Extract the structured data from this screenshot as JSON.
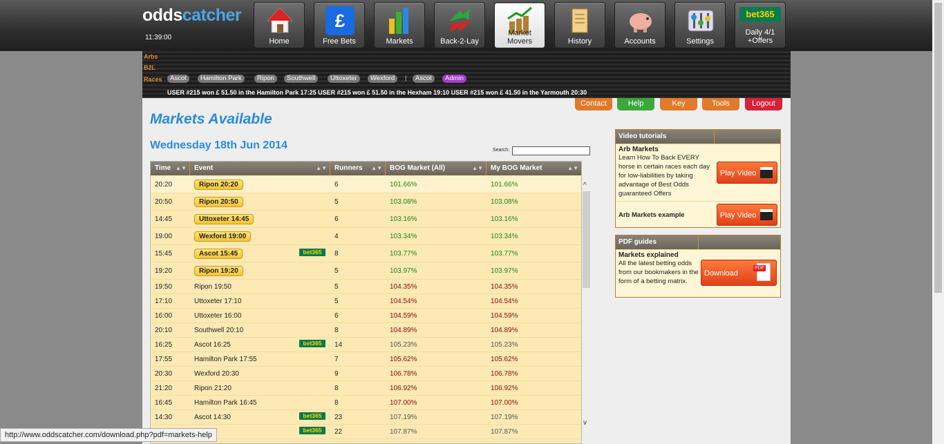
{
  "brand": {
    "part1": "odds",
    "part2": "catcher"
  },
  "clock": "11:39:00",
  "nav": [
    {
      "label": "Home",
      "icon": "house-icon"
    },
    {
      "label": "Free Bets",
      "icon": "pound-icon"
    },
    {
      "label": "Markets",
      "icon": "bar-chart-icon"
    },
    {
      "label": "Back-2-Lay",
      "icon": "arrows-icon"
    },
    {
      "label": "Market Movers",
      "icon": "coins-chart-icon"
    },
    {
      "label": "History",
      "icon": "scroll-icon"
    },
    {
      "label": "Accounts",
      "icon": "piggy-bank-icon"
    },
    {
      "label": "Settings",
      "icon": "settings-icon"
    },
    {
      "label": "Daily 4/1 +Offers",
      "icon": "bet365-icon",
      "badge": "bet365"
    }
  ],
  "subnav": {
    "arbs": "Arbs",
    "b2l": "B2L",
    "races": "Races",
    "race_pills": [
      "Ascot",
      "Hamilton Park",
      "Ripon",
      "Southwell",
      "Uttoxeter",
      "Wexford"
    ],
    "separator": "|",
    "extra_pills": [
      "Ascot",
      "Admin"
    ],
    "ticker": "USER #215 won £ 51.50 in the Hamilton Park 17:25     USER #215 won £ 51.50 in the Hexham 19:10     USER #215 won £ 41.50 in the Yarmouth 20:30"
  },
  "top_buttons": [
    {
      "label": "Contact",
      "color": "#e07a2a"
    },
    {
      "label": "Help",
      "color": "#3aa83a"
    },
    {
      "label": "Key",
      "color": "#e07a2a"
    },
    {
      "label": "Tools",
      "color": "#e07a2a"
    },
    {
      "label": "Logout",
      "color": "#d8203a"
    }
  ],
  "title": "Markets Available",
  "date": "Wednesday 18th Jun 2014",
  "search_label": "Search:",
  "columns": [
    "Time",
    "Event",
    "Runners",
    "BOG Market (All)",
    "My BOG Market"
  ],
  "rows": [
    {
      "time": "20:20",
      "event": "Ripon 20:20",
      "runners": "6",
      "bog": "101.66%",
      "my": "101.66%",
      "btn": true,
      "b365": false,
      "cls": "g"
    },
    {
      "time": "20:50",
      "event": "Ripon 20:50",
      "runners": "5",
      "bog": "103.08%",
      "my": "103.08%",
      "btn": true,
      "b365": false,
      "cls": "g"
    },
    {
      "time": "14:45",
      "event": "Uttoxeter 14:45",
      "runners": "6",
      "bog": "103.16%",
      "my": "103.16%",
      "btn": true,
      "b365": false,
      "cls": "g"
    },
    {
      "time": "19:00",
      "event": "Wexford 19:00",
      "runners": "4",
      "bog": "103.34%",
      "my": "103.34%",
      "btn": true,
      "b365": false,
      "cls": "g"
    },
    {
      "time": "15:45",
      "event": "Ascot 15:45",
      "runners": "8",
      "bog": "103.77%",
      "my": "103.77%",
      "btn": true,
      "b365": true,
      "cls": "g"
    },
    {
      "time": "19:20",
      "event": "Ripon 19:20",
      "runners": "5",
      "bog": "103.97%",
      "my": "103.97%",
      "btn": true,
      "b365": false,
      "cls": "g"
    },
    {
      "time": "19:50",
      "event": "Ripon 19:50",
      "runners": "5",
      "bog": "104.35%",
      "my": "104.35%",
      "btn": false,
      "b365": false,
      "cls": "r"
    },
    {
      "time": "17:10",
      "event": "Uttoxeter 17:10",
      "runners": "5",
      "bog": "104.54%",
      "my": "104.54%",
      "btn": false,
      "b365": false,
      "cls": "r"
    },
    {
      "time": "16:00",
      "event": "Uttoxeter 16:00",
      "runners": "6",
      "bog": "104.59%",
      "my": "104.59%",
      "btn": false,
      "b365": false,
      "cls": "r"
    },
    {
      "time": "20:10",
      "event": "Southwell 20:10",
      "runners": "8",
      "bog": "104.89%",
      "my": "104.89%",
      "btn": false,
      "b365": false,
      "cls": "r"
    },
    {
      "time": "16:25",
      "event": "Ascot 16:25",
      "runners": "14",
      "bog": "105.23%",
      "my": "105.23%",
      "btn": false,
      "b365": true,
      "cls": "gy"
    },
    {
      "time": "17:55",
      "event": "Hamilton Park 17:55",
      "runners": "7",
      "bog": "105.62%",
      "my": "105.62%",
      "btn": false,
      "b365": false,
      "cls": "r"
    },
    {
      "time": "20:30",
      "event": "Wexford 20:30",
      "runners": "9",
      "bog": "106.78%",
      "my": "106.78%",
      "btn": false,
      "b365": false,
      "cls": "r"
    },
    {
      "time": "21:20",
      "event": "Ripon 21:20",
      "runners": "8",
      "bog": "106.92%",
      "my": "106.92%",
      "btn": false,
      "b365": false,
      "cls": "r"
    },
    {
      "time": "16:45",
      "event": "Hamilton Park 16:45",
      "runners": "8",
      "bog": "107.00%",
      "my": "107.00%",
      "btn": false,
      "b365": false,
      "cls": "r"
    },
    {
      "time": "14:30",
      "event": "Ascot 14:30",
      "runners": "23",
      "bog": "107.19%",
      "my": "107.19%",
      "btn": false,
      "b365": true,
      "cls": "gy"
    },
    {
      "time": "",
      "event": "",
      "runners": "22",
      "bog": "107.87%",
      "my": "107.87%",
      "btn": false,
      "b365": true,
      "cls": "gy"
    }
  ],
  "video_panel": {
    "title": "Video tutorials",
    "items": [
      {
        "title": "Arb Markets",
        "desc": "Learn How To Back EVERY horse in certain races each day for low-liabilities by taking advantage of Best Odds guaranteed Offers",
        "button": "Play Video"
      },
      {
        "title": "Arb Markets example",
        "desc": "",
        "button": "Play Video"
      }
    ]
  },
  "pdf_panel": {
    "title": "PDF guides",
    "items": [
      {
        "title": "Markets explained",
        "desc": "All the latest betting odds from our bookmakers in the form of a betting matrix.",
        "button": "Download",
        "badge": "PDF"
      }
    ]
  },
  "status_url": "http://www.oddscatcher.com/download.php?pdf=markets-help",
  "scroll_up": "^",
  "scroll_down": "v"
}
